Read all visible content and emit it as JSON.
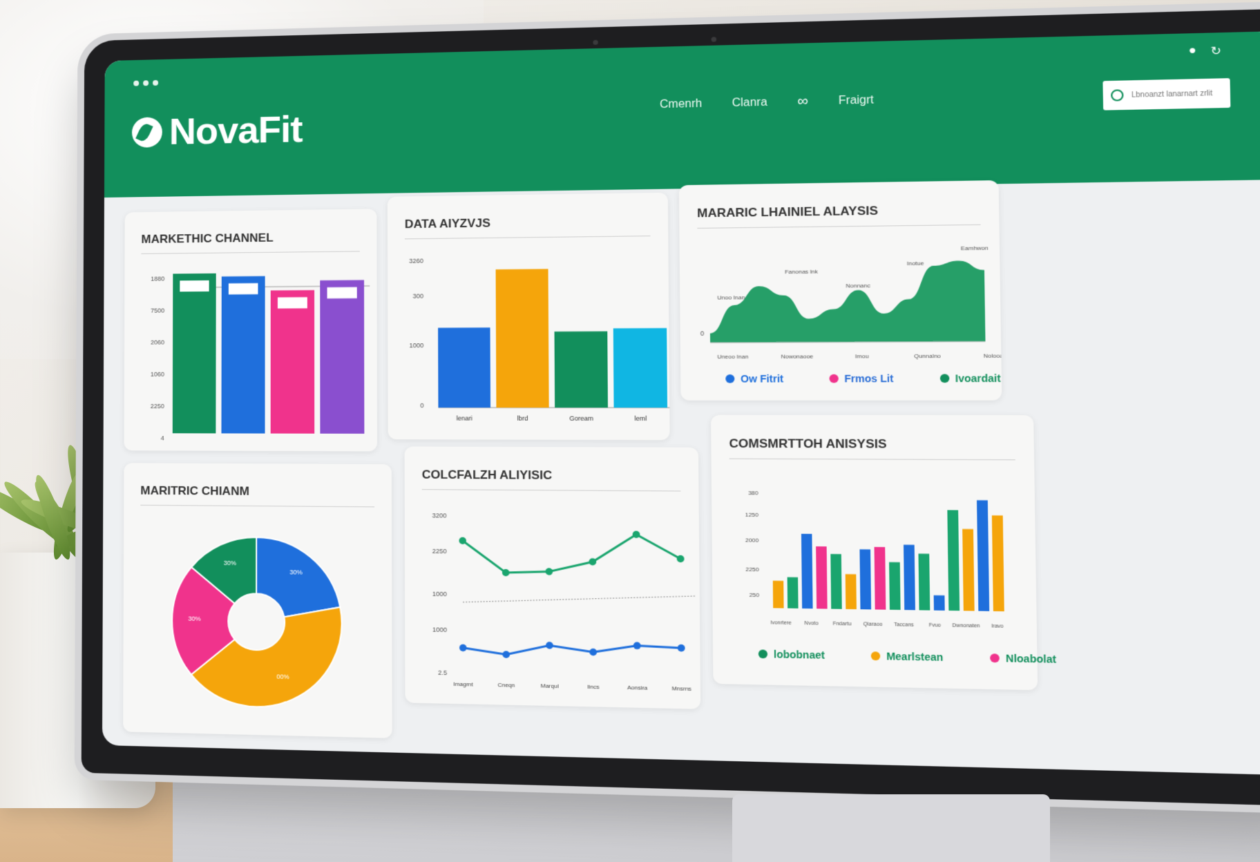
{
  "app": {
    "logo_text": "NovaFit"
  },
  "header": {
    "nav": [
      {
        "label": "Cmenrh"
      },
      {
        "label": "Clanra"
      },
      {
        "label": "Fraigrt"
      }
    ],
    "search": {
      "placeholder": "Lbnoanzt lanarnart zrlit"
    }
  },
  "colors": {
    "brand_green": "#128f5c",
    "blue": "#1f6fdc",
    "orange": "#f5a50b",
    "pink": "#f0338c",
    "purple": "#8a4fcf",
    "cyan": "#10b6e3"
  },
  "panels": {
    "p1": {
      "title": "MARKETHIC CHANNEL",
      "chart_data": {
        "type": "bar",
        "y_ticks": [
          "1880",
          "7500",
          "2060",
          "1060",
          "2250",
          "4"
        ],
        "values": [
          100,
          98,
          89,
          95
        ],
        "colors": [
          "#128f5c",
          "#1f6fdc",
          "#f0338c",
          "#8a4fcf"
        ]
      }
    },
    "p2": {
      "title": "DATA AIYZVJS",
      "chart_data": {
        "type": "bar",
        "categories": [
          "lenari",
          "lbrd",
          "Goream",
          "leml"
        ],
        "y_ticks": [
          "3260",
          "300",
          "1000",
          "0"
        ],
        "values": [
          55,
          95,
          52,
          54
        ],
        "colors": [
          "#1f6fdc",
          "#f5a50b",
          "#128f5c",
          "#10b6e3"
        ]
      }
    },
    "p3": {
      "title": "MARARIC LHAINIEL ALAYSIS",
      "chart_data": {
        "type": "area",
        "y_ticks": [
          "0"
        ],
        "x": [
          "Uneoo Inan",
          "Nowonaooe",
          "Imou",
          "Qunnalno",
          "Nolooa"
        ],
        "values": [
          10,
          40,
          60,
          50,
          25,
          35,
          55,
          30,
          45,
          80,
          85,
          75
        ],
        "annotations": [
          "Unoo Inan",
          "Fanonas lnk",
          "Nonnanc",
          "Inotue",
          "Eamhwon"
        ]
      },
      "legend": [
        {
          "label": "Ow Fitrit",
          "color": "#1f6fdc"
        },
        {
          "label": "Frmos Lit",
          "color": "#f0338c"
        },
        {
          "label": "Ivoardait",
          "color": "#128f5c"
        }
      ]
    },
    "p4": {
      "title": "MARITRIC CHIANM",
      "chart_data": {
        "type": "pie",
        "slices": [
          {
            "label": "30%",
            "value": 22,
            "color": "#1f6fdc"
          },
          {
            "label": "00%",
            "value": 42,
            "color": "#f5a50b"
          },
          {
            "label": "30%",
            "value": 22,
            "color": "#f0338c"
          },
          {
            "label": "30%",
            "value": 14,
            "color": "#128f5c"
          }
        ]
      }
    },
    "p5": {
      "title": "COLCFALZH ALIYISIC",
      "chart_data": {
        "type": "line",
        "categories": [
          "Imagrnt",
          "Cneqn",
          "Marqul",
          "lincs",
          "Aonsira",
          "Mnsrns"
        ],
        "y_ticks": [
          "3200",
          "2250",
          "1000",
          "1000",
          "2.5"
        ],
        "series": [
          {
            "values": [
              80,
              40,
              42,
              55,
              90,
              60
            ],
            "color": "#1aa56e"
          },
          {
            "values": [
              15,
              0,
              25,
              10,
              28,
              24
            ],
            "color": "#1f6fdc"
          }
        ]
      }
    },
    "p6": {
      "title": "COMSMRTTOH ANISYSIS",
      "chart_data": {
        "type": "bar",
        "y_ticks": [
          "380",
          "1250",
          "2000",
          "2250",
          "250"
        ],
        "categories": [
          "Ivonrtere",
          "Nvoto",
          "Fndartu",
          "Qlaraoo",
          "Taccans",
          "Fvuo",
          "Dwnonaten",
          "Iravo"
        ],
        "series_values": [
          22,
          25,
          60,
          50,
          44,
          28,
          48,
          50,
          38,
          52,
          45,
          12,
          80,
          65,
          88,
          76
        ],
        "series_colors": [
          "#f5a50b",
          "#1aa56e",
          "#1f6fdc",
          "#f0338c",
          "#1aa56e",
          "#f5a50b",
          "#1f6fdc",
          "#f0338c",
          "#1aa56e",
          "#1f6fdc",
          "#1aa56e",
          "#1f6fdc",
          "#1aa56e",
          "#f5a50b",
          "#1f6fdc",
          "#f5a50b"
        ]
      },
      "legend": [
        {
          "label": "lobobnaet",
          "color": "#128f5c"
        },
        {
          "label": "Mearlstean",
          "color": "#f5a50b"
        },
        {
          "label": "Nloabolat",
          "color": "#f0338c"
        }
      ]
    }
  }
}
